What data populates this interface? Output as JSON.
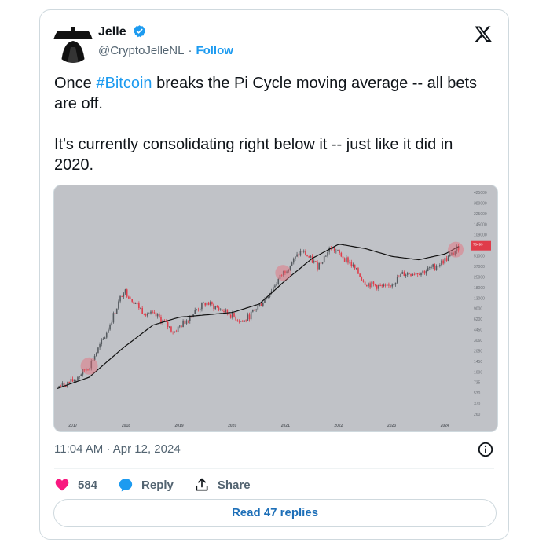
{
  "author": {
    "name": "Jelle",
    "handle": "@CryptoJelleNL",
    "separator": "·",
    "follow_label": "Follow"
  },
  "tweet": {
    "line1_before": "Once ",
    "hashtag": "#Bitcoin",
    "line1_after": " breaks the Pi Cycle moving average -- all bets are off.",
    "paragraph2": "It's currently consolidating right below it -- just like it did in 2020."
  },
  "timestamp": "11:04 AM · Apr 12, 2024",
  "actions": {
    "likes": "584",
    "reply_label": "Reply",
    "share_label": "Share"
  },
  "read_replies": "Read 47 replies",
  "colors": {
    "accent": "#1d9bf0",
    "like": "#f91880",
    "chart_bg": "#c0c2c7",
    "candle_up": "#555a5f",
    "candle_down": "#e03c4a"
  },
  "icons": [
    "verified-badge-icon",
    "x-logo-icon",
    "info-icon",
    "heart-icon",
    "reply-bubble-icon",
    "share-icon"
  ],
  "chart_data": {
    "type": "line",
    "x_tick_labels": [
      "2017",
      "2018",
      "2019",
      "2020",
      "2021",
      "2022",
      "2023",
      "2024"
    ],
    "y_scale": "log",
    "y_tick_labels": [
      "425000",
      "380000",
      "225000",
      "145000",
      "109000",
      "73000",
      "51000",
      "37000",
      "25000",
      "18000",
      "13000",
      "9000",
      "6200",
      "4450",
      "3060",
      "2050",
      "1450",
      "1000",
      "735",
      "530",
      "370",
      "260"
    ],
    "price_label": "70493",
    "series": [
      {
        "x": [
          2016.7,
          2017.0,
          2017.3,
          2017.6,
          2017.95,
          2018.3,
          2018.6,
          2018.9,
          2019.3,
          2019.5,
          2019.9,
          2020.2,
          2020.6,
          2020.95,
          2021.3,
          2021.6,
          2021.85,
          2022.2,
          2022.5,
          2022.9,
          2023.2,
          2023.6,
          2023.9,
          2024.15,
          2024.28
        ],
        "values": [
          650,
          800,
          1300,
          3500,
          16000,
          8000,
          6500,
          4000,
          8000,
          10500,
          7500,
          5500,
          11500,
          28000,
          58000,
          35000,
          65000,
          40000,
          20000,
          16800,
          27000,
          29000,
          38000,
          52000,
          70000
        ]
      },
      {
        "x": [
          2016.7,
          2017.3,
          2017.95,
          2018.5,
          2019.0,
          2019.5,
          2020.0,
          2020.5,
          2021.0,
          2021.5,
          2022.0,
          2022.5,
          2023.0,
          2023.5,
          2024.0,
          2024.28
        ],
        "values": [
          620,
          900,
          2400,
          5000,
          6500,
          7000,
          7600,
          10000,
          22000,
          45000,
          72000,
          62000,
          48000,
          43000,
          52000,
          68000
        ]
      }
    ]
  }
}
